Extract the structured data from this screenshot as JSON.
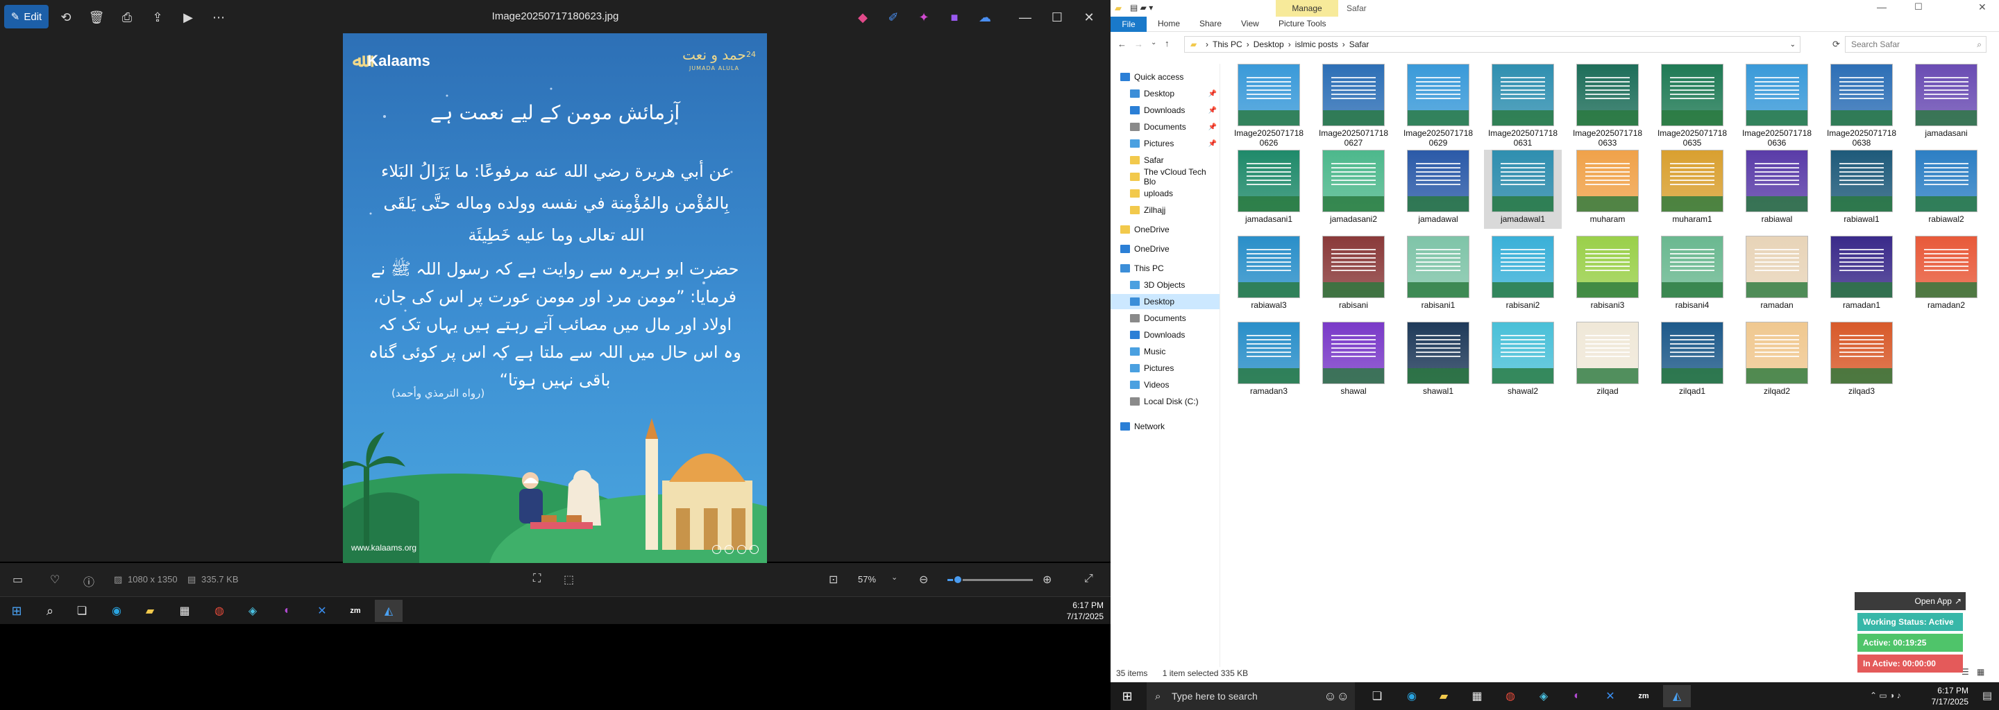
{
  "photos": {
    "edit_label": "Edit",
    "filename": "Image20250717180623.jpg",
    "dimensions": "1080 x 1350",
    "filesize": "335.7 KB",
    "zoom": "57%",
    "zoom_fraction": 0.12
  },
  "poster": {
    "brand": "Kalaams",
    "emblem_text": "حمد و نعت",
    "emblem_num": "24",
    "emblem_sub": "JUMADA ALULA",
    "heading": "آزمائش مومن کے لیے نعمت ہے",
    "arabic": "عن أبي هريرة رضي الله عنه مرفوعًا: ما يَزَالُ البَلاء بِالمُؤْمن والمُؤْمِنة في نفسه وولده وماله حتَّى يَلقَى الله تعالى وما عليه خَطِيئَة",
    "urdu": "حضرت ابو ہریرہ سے روایت ہے کہ رسول اللہ ﷺ نے فرمایا: ”مومن مرد اور مومن عورت پر اس کی جان، اولاد اور مال میں مصائب آتے رہتے ہیں یہاں تک کہ وہ اس حال میں اللہ سے ملتا ہے کہ اس پر کوئی گناہ باقی نہیں ہوتا“",
    "reference": "(رواه الترمذي وأحمد)",
    "website": "www.kalaams.org"
  },
  "taskbar1": {
    "time": "6:17 PM",
    "date": "7/17/2025"
  },
  "explorer": {
    "manage_label": "Manage",
    "window_title": "Safar",
    "tabs": [
      "File",
      "Home",
      "Share",
      "View",
      "Picture Tools"
    ],
    "breadcrumb": [
      "This PC",
      "Desktop",
      "islmic posts",
      "Safar"
    ],
    "search_placeholder": "Search Safar",
    "nav": [
      {
        "label": "Quick access",
        "color": "#2b7fd6",
        "pinned": false
      },
      {
        "label": "Desktop",
        "color": "#3c8ed8",
        "pinned": true
      },
      {
        "label": "Downloads",
        "color": "#2b7fd6",
        "pinned": true
      },
      {
        "label": "Documents",
        "color": "#8a8a8a",
        "pinned": true
      },
      {
        "label": "Pictures",
        "color": "#4aa0e0",
        "pinned": true
      },
      {
        "label": "Safar",
        "color": "#f2c94c",
        "pinned": false
      },
      {
        "label": "The vCloud Tech Blo",
        "color": "#f2c94c",
        "pinned": false
      },
      {
        "label": "uploads",
        "color": "#f2c94c",
        "pinned": false
      },
      {
        "label": "Zilhajj",
        "color": "#f2c94c",
        "pinned": false
      },
      {
        "label": "OneDrive",
        "color": "#f2c94c",
        "pinned": false
      },
      {
        "label": "OneDrive",
        "color": "#2b7fd6",
        "pinned": false
      },
      {
        "label": "This PC",
        "color": "#3c8ed8",
        "pinned": false
      },
      {
        "label": "3D Objects",
        "color": "#4aa0e0",
        "pinned": false
      },
      {
        "label": "Desktop",
        "color": "#3c8ed8",
        "pinned": false
      },
      {
        "label": "Documents",
        "color": "#8a8a8a",
        "pinned": false
      },
      {
        "label": "Downloads",
        "color": "#2b7fd6",
        "pinned": false
      },
      {
        "label": "Music",
        "color": "#4aa0e0",
        "pinned": false
      },
      {
        "label": "Pictures",
        "color": "#4aa0e0",
        "pinned": false
      },
      {
        "label": "Videos",
        "color": "#4aa0e0",
        "pinned": false
      },
      {
        "label": "Local Disk (C:)",
        "color": "#8a8a8a",
        "pinned": false
      },
      {
        "label": "Network",
        "color": "#2b7fd6",
        "pinned": false
      }
    ],
    "files": [
      {
        "l1": "Image2025071718",
        "l2": "0626",
        "color": "#3a9ad9"
      },
      {
        "l1": "Image2025071718",
        "l2": "0627",
        "color": "#2d6fb6"
      },
      {
        "l1": "Image2025071718",
        "l2": "0629",
        "color": "#3a9ad9"
      },
      {
        "l1": "Image2025071718",
        "l2": "0631",
        "color": "#2f8fb0"
      },
      {
        "l1": "Image2025071718",
        "l2": "0633",
        "color": "#1e6e5a"
      },
      {
        "l1": "Image2025071718",
        "l2": "0635",
        "color": "#1f7a55"
      },
      {
        "l1": "Image2025071718",
        "l2": "0636",
        "color": "#3a9ad9"
      },
      {
        "l1": "Image2025071718",
        "l2": "0638",
        "color": "#2d6fb6"
      },
      {
        "l1": "jamadasani",
        "l2": "",
        "color": "#6a4cb3"
      },
      {
        "l1": "jamadasani1",
        "l2": "",
        "color": "#1f8a6a"
      },
      {
        "l1": "jamadasani2",
        "l2": "",
        "color": "#4db88c"
      },
      {
        "l1": "jamadawal",
        "l2": "",
        "color": "#2b5aa8"
      },
      {
        "l1": "jamadawal1",
        "l2": "",
        "color": "#2f8fb0"
      },
      {
        "l1": "muharam",
        "l2": "",
        "color": "#f0a24a"
      },
      {
        "l1": "muharam1",
        "l2": "",
        "color": "#d9a030"
      },
      {
        "l1": "rabiawal",
        "l2": "",
        "color": "#5a3ca8"
      },
      {
        "l1": "rabiawal1",
        "l2": "",
        "color": "#1e5a7a"
      },
      {
        "l1": "rabiawal2",
        "l2": "",
        "color": "#2d7fc4"
      },
      {
        "l1": "rabiawal3",
        "l2": "",
        "color": "#2a8fc9"
      },
      {
        "l1": "rabisani",
        "l2": "",
        "color": "#8a3a3a"
      },
      {
        "l1": "rabisani1",
        "l2": "",
        "color": "#7fc4a8"
      },
      {
        "l1": "rabisani2",
        "l2": "",
        "color": "#3ab0d8"
      },
      {
        "l1": "rabisani3",
        "l2": "",
        "color": "#9ad04a"
      },
      {
        "l1": "rabisani4",
        "l2": "",
        "color": "#6ab890"
      },
      {
        "l1": "ramadan",
        "l2": "",
        "color": "#e8d4b8"
      },
      {
        "l1": "ramadan1",
        "l2": "",
        "color": "#3a2a8a"
      },
      {
        "l1": "ramadan2",
        "l2": "",
        "color": "#e85a3a"
      },
      {
        "l1": "ramadan3",
        "l2": "",
        "color": "#2a8fc9"
      },
      {
        "l1": "shawal",
        "l2": "",
        "color": "#7a3ac8"
      },
      {
        "l1": "shawal1",
        "l2": "",
        "color": "#1f3a5a"
      },
      {
        "l1": "shawal2",
        "l2": "",
        "color": "#4ac0d8"
      },
      {
        "l1": "zilqad",
        "l2": "",
        "color": "#f0e8d8"
      },
      {
        "l1": "zilqad1",
        "l2": "",
        "color": "#1e5a8a"
      },
      {
        "l1": "zilqad2",
        "l2": "",
        "color": "#f0c890"
      },
      {
        "l1": "zilqad3",
        "l2": "",
        "color": "#d85a2a"
      }
    ],
    "status_items": "35 items",
    "status_selected": "1 item selected  335 KB"
  },
  "tracker": {
    "open_label": "Open App",
    "status": "Working Status: Active",
    "active": "Active: 00:19:25",
    "inactive": "In Active: 00:00:00"
  },
  "taskbar2": {
    "search_placeholder": "Type here to search",
    "time": "6:17 PM",
    "date": "7/17/2025"
  },
  "colors": {
    "accent": "#1979ca",
    "photos_bg": "#202020",
    "poster_top": "#2d70b6",
    "tracker_status": "#37b7a8",
    "tracker_active": "#4fc46a",
    "tracker_inactive": "#e45a5a"
  }
}
